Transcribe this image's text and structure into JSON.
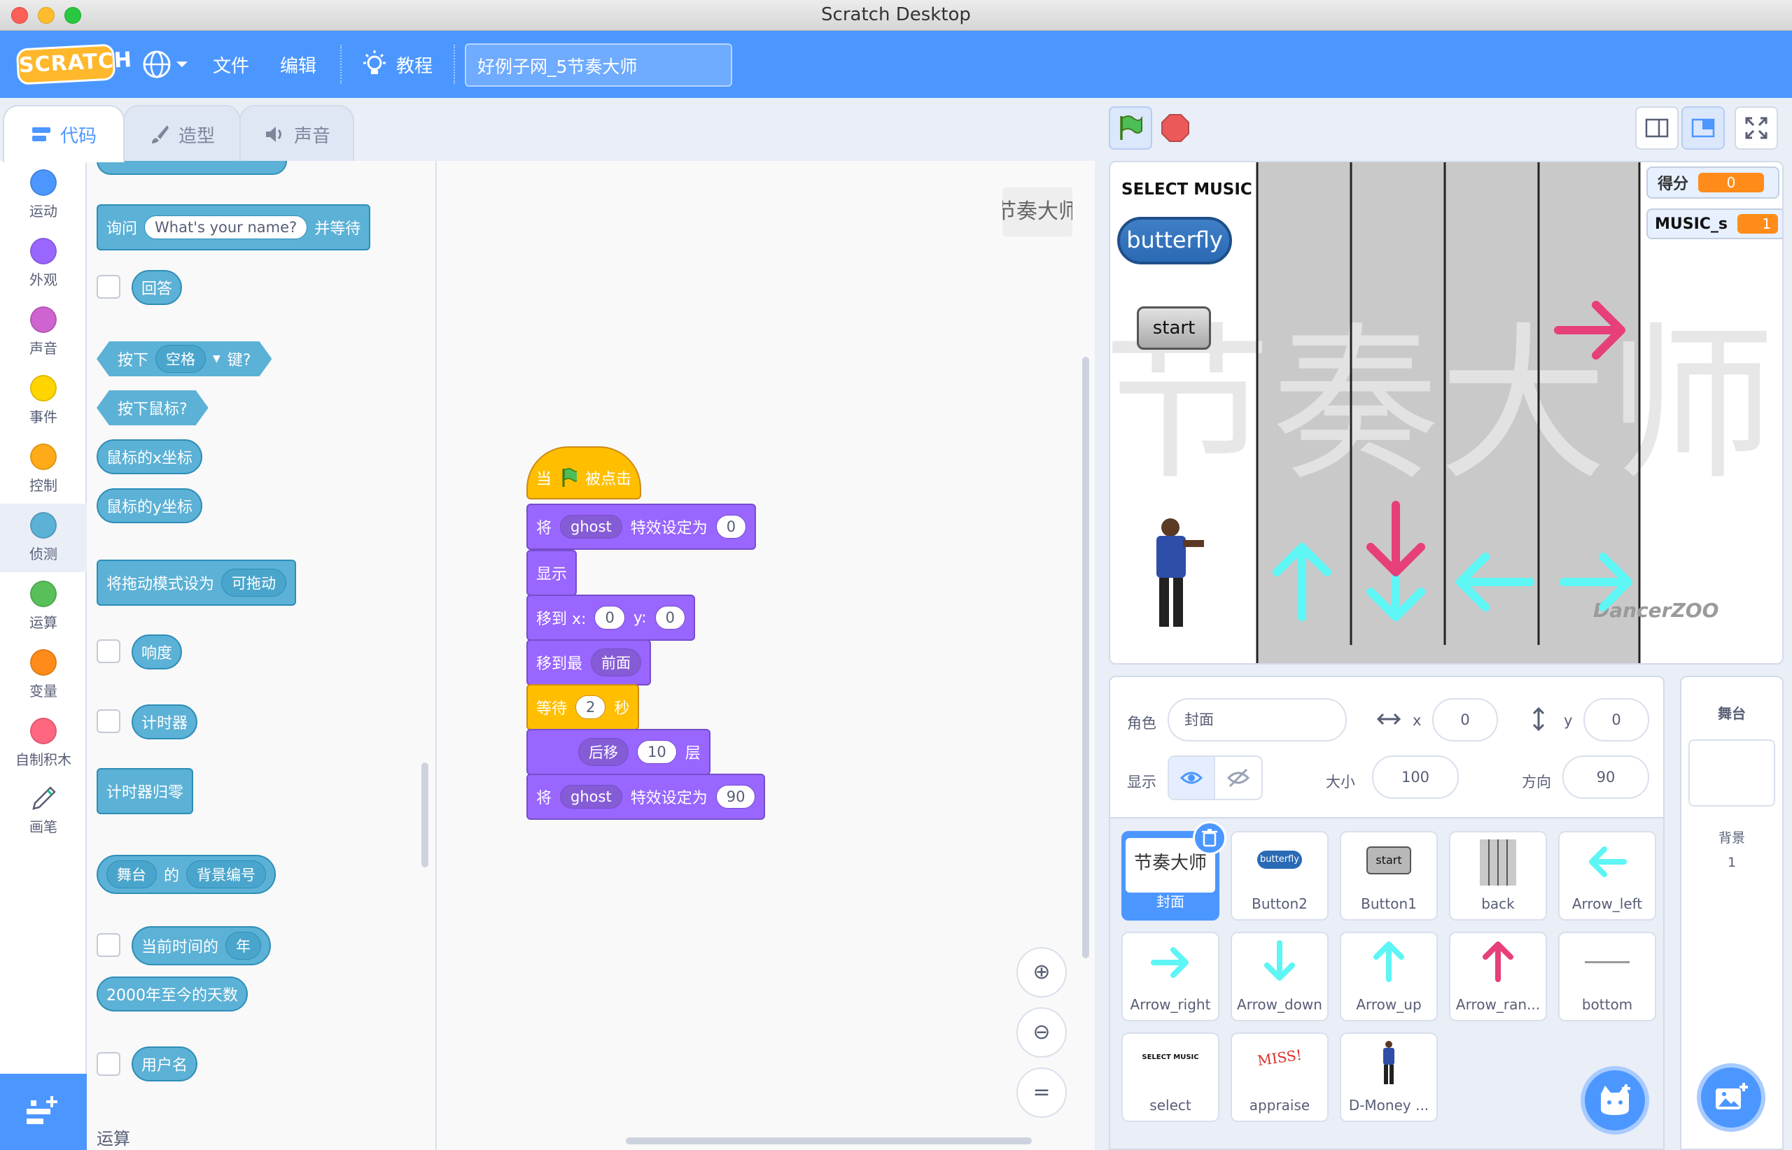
{
  "window": {
    "title": "Scratch Desktop"
  },
  "menubar": {
    "logo": "SCRATCH",
    "file": "文件",
    "edit": "编辑",
    "tutorials": "教程",
    "project_title": "好例子网_5节奏大师"
  },
  "tabs": {
    "code": "代码",
    "costumes": "造型",
    "sounds": "声音"
  },
  "categories": [
    "运动",
    "外观",
    "声音",
    "事件",
    "控制",
    "侦测",
    "运算",
    "变量",
    "自制积木",
    "画笔"
  ],
  "category_colors": [
    "#4c97ff",
    "#9966ff",
    "#cf63cf",
    "#ffd500",
    "#ffab19",
    "#5cb1d6",
    "#59c059",
    "#ff8c1a",
    "#ff6680",
    "#0fbd8c"
  ],
  "palette": {
    "ask_pre": "询问",
    "ask_input": "What's your name?",
    "ask_post": "并等待",
    "answer": "回答",
    "key_pre": "按下",
    "key_dd": "空格",
    "key_post": "键?",
    "mouse_down": "按下鼠标?",
    "mouse_x": "鼠标的x坐标",
    "mouse_y": "鼠标的y坐标",
    "drag_pre": "将拖动模式设为",
    "drag_dd": "可拖动",
    "loudness": "响度",
    "timer": "计时器",
    "reset_timer": "计时器归零",
    "of_dd1": "舞台",
    "of_mid": "的",
    "of_dd2": "背景编号",
    "current_pre": "当前时间的",
    "current_dd": "年",
    "days": "2000年至今的天数",
    "username": "用户名",
    "section_operators": "运算"
  },
  "script": {
    "hat_pre": "当",
    "hat_post": "被点击",
    "b1_pre": "将",
    "b1_dd": "ghost",
    "b1_mid": "特效设定为",
    "b1_val": "0",
    "b2": "显示",
    "b3_pre": "移到 x:",
    "b3_x": "0",
    "b3_ylbl": "y:",
    "b3_y": "0",
    "b4_pre": "移到最",
    "b4_dd": "前面",
    "b5_pre": "等待",
    "b5_val": "2",
    "b5_post": "秒",
    "b6_dd": "后移",
    "b6_val": "10",
    "b6_post": "层",
    "b7_pre": "将",
    "b7_dd": "ghost",
    "b7_mid": "特效设定为",
    "b7_val": "90"
  },
  "stage": {
    "select_music": "SELECT MUSIC",
    "butterfly": "butterfly",
    "start": "start",
    "score_label": "得分",
    "score_value": "0",
    "music_label": "MUSIC_s",
    "music_value": "1",
    "watermark": "节奏大师",
    "dancer_logo": "DancerZOO"
  },
  "sprite_info": {
    "sprite_label": "角色",
    "sprite_name": "封面",
    "x_label": "x",
    "x_value": "0",
    "y_label": "y",
    "y_value": "0",
    "show_label": "显示",
    "size_label": "大小",
    "size_value": "100",
    "direction_label": "方向",
    "direction_value": "90"
  },
  "sprites": [
    "封面",
    "Button2",
    "Button1",
    "back",
    "Arrow_left",
    "Arrow_right",
    "Arrow_down",
    "Arrow_up",
    "Arrow_ran...",
    "bottom",
    "select",
    "appraise",
    "D-Money ..."
  ],
  "sprite_thumbs": {
    "button2": "butterfly",
    "button1": "start",
    "select": "SELECT MUSIC",
    "appraise": "MISS!"
  },
  "stage_panel": {
    "title": "舞台",
    "backdrops_label": "背景",
    "backdrops_count": "1"
  }
}
